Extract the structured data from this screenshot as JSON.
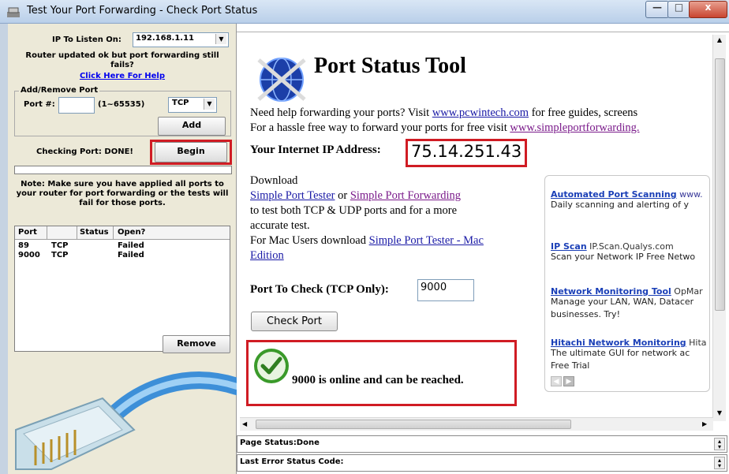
{
  "window": {
    "title": "Test Your Port Forwarding - Check Port Status"
  },
  "left": {
    "ip_label": "IP To Listen On:",
    "ip_value": "192.168.1.11",
    "router_msg_line1": "Router updated ok but port forwarding still",
    "router_msg_line2": "fails?",
    "help_link": "Click Here For Help",
    "add_remove_title": "Add/Remove Port",
    "port_label": "Port #:",
    "port_range": "(1~65535)",
    "protocol": "TCP",
    "add_button": "Add",
    "checking_status": "Checking Port: DONE!",
    "begin_button": "Begin",
    "note_line1": "Note: Make sure you have applied all ports to",
    "note_line2": "your router for port forwarding or the tests will",
    "note_line3": "fail for those ports.",
    "list_headers": [
      "Port",
      "",
      "Status",
      "Open?"
    ],
    "rows": [
      {
        "port": "89",
        "proto": "TCP",
        "status": "",
        "open": "Failed"
      },
      {
        "port": "9000",
        "proto": "TCP",
        "status": "",
        "open": "Failed"
      }
    ],
    "remove_button": "Remove"
  },
  "page": {
    "heading": "Port Status Tool",
    "help_line1_pre": "Need help forwarding your ports? Visit ",
    "help_line1_link": "www.pcwintech.com",
    "help_line1_post": " for free guides, screens",
    "help_line2_pre": "For a hassle free way to forward your ports for free visit ",
    "help_line2_link": "www.simpleportforwarding.",
    "ip_label": "Your Internet IP Address:",
    "ip_value": "75.14.251.43",
    "download": "Download",
    "dl_link1": "Simple Port Tester",
    "dl_or": " or ",
    "dl_link2": "Simple Port Forwarding",
    "dl_line2": "to test both TCP & UDP ports and for a more",
    "dl_line3": "accurate test.",
    "mac_pre": "For Mac Users download ",
    "mac_link1": "Simple Port Tester - Mac",
    "mac_link2": "Edition",
    "port_check_label": "Port To Check (TCP Only):",
    "port_check_value": "9000",
    "check_button": "Check Port",
    "result": "9000 is online and can be reached."
  },
  "ads": [
    {
      "title": "Automated Port Scanning",
      "url": " www.",
      "desc": "Daily scanning and alerting of y"
    },
    {
      "title": "IP Scan",
      "url": " IP.Scan.Qualys.com",
      "desc": "Scan your Network IP Free Netwo"
    },
    {
      "title": "Network Monitoring Tool",
      "url": " OpMar",
      "desc": "Manage your LAN, WAN, Datacer",
      "desc2": "businesses. Try!"
    },
    {
      "title": "Hitachi Network Monitoring",
      "url": " Hita",
      "desc": "The ultimate GUI for network ac",
      "desc2": "Free Trial"
    }
  ],
  "status": {
    "page_status": "Page Status:Done",
    "last_error": "Last Error Status Code:"
  },
  "colors": {
    "accent_red": "#d01c24",
    "link_blue": "#0000ee",
    "check_green": "#3a9a2a"
  }
}
